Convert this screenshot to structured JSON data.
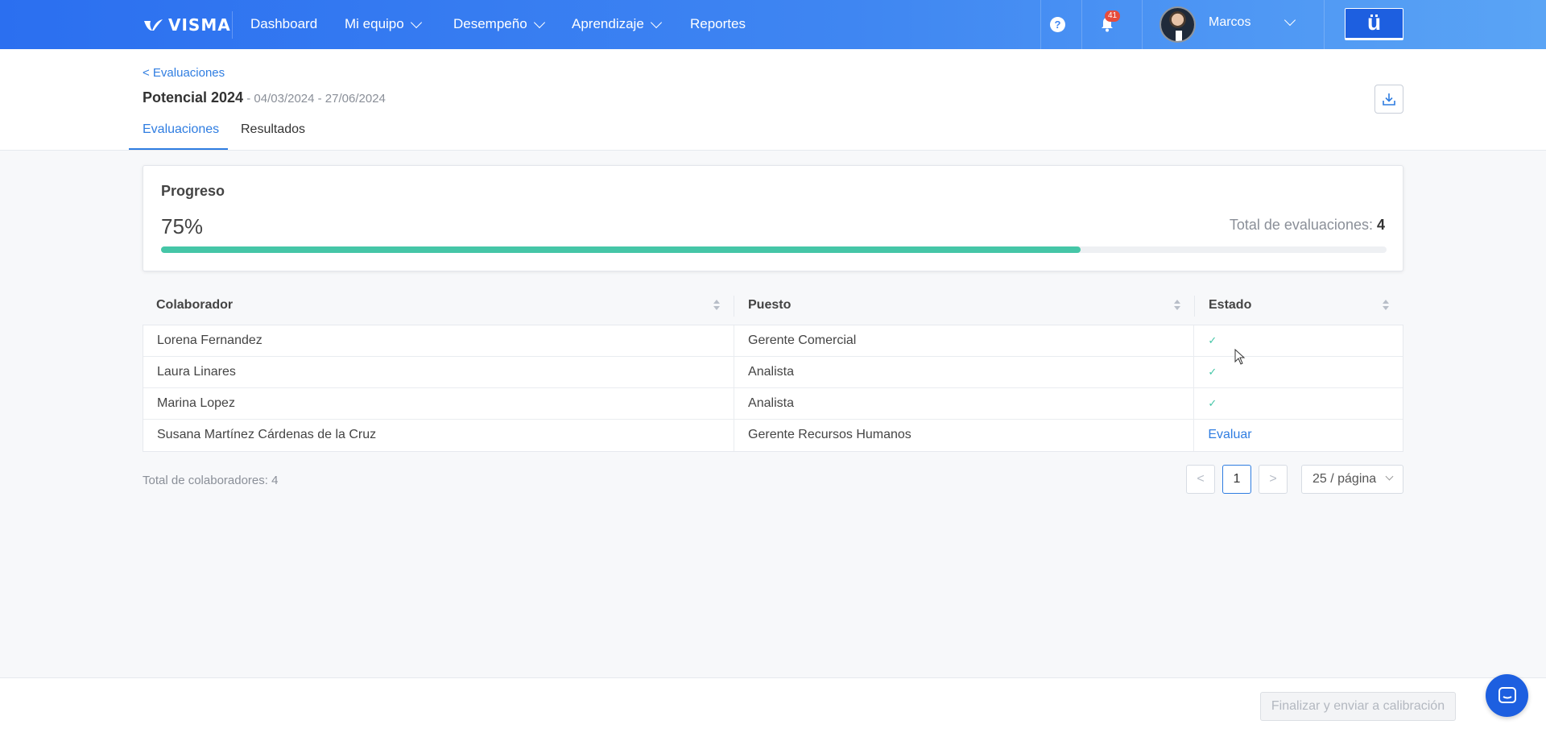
{
  "brand": {
    "logo_text": "VISMA"
  },
  "nav": {
    "items": [
      {
        "label": "Dashboard",
        "dropdown": false
      },
      {
        "label": "Mi equipo",
        "dropdown": true
      },
      {
        "label": "Desempeño",
        "dropdown": true
      },
      {
        "label": "Aprendizaje",
        "dropdown": true
      },
      {
        "label": "Reportes",
        "dropdown": false
      }
    ],
    "help_label": "?",
    "notifications_count": "41",
    "user_name": "Marcos",
    "app_button_label": "ü"
  },
  "header": {
    "back_label": "< Evaluaciones",
    "title": "Potencial 2024",
    "dates": " - 04/03/2024 - 27/06/2024",
    "tabs": [
      {
        "label": "Evaluaciones",
        "active": true
      },
      {
        "label": "Resultados",
        "active": false
      }
    ]
  },
  "progress": {
    "title": "Progreso",
    "percent_label": "75%",
    "percent_value": 0.75,
    "total_label": "Total de evaluaciones:",
    "total_value": "4",
    "bar_color": "#45c6a7"
  },
  "table": {
    "columns": [
      "Colaborador",
      "Puesto",
      "Estado"
    ],
    "rows": [
      {
        "colaborador": "Lorena Fernandez",
        "puesto": "Gerente Comercial",
        "estado": "✓"
      },
      {
        "colaborador": "Laura Linares",
        "puesto": "Analista",
        "estado": "✓"
      },
      {
        "colaborador": "Marina Lopez",
        "puesto": "Analista",
        "estado": "✓"
      },
      {
        "colaborador": "Susana Martínez Cárdenas de la Cruz",
        "puesto": "Gerente Recursos Humanos",
        "estado": "Evaluar"
      }
    ]
  },
  "footer_info": {
    "total_colaboradores": "Total de colaboradores: 4"
  },
  "pagination": {
    "prev": "<",
    "current": "1",
    "next": ">",
    "page_size": "25 / página"
  },
  "footer": {
    "finalize_label": "Finalizar y enviar a calibración"
  },
  "colors": {
    "accent": "#2f7de1",
    "nav_gradient_start": "#2b6ff0",
    "nav_gradient_end": "#5aa4f5",
    "success": "#45c6a7"
  }
}
